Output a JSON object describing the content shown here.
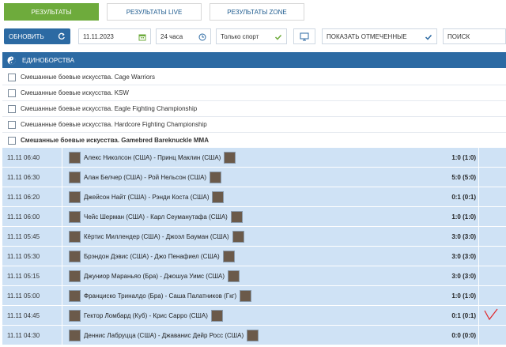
{
  "tabs": [
    {
      "label": "РЕЗУЛЬТАТЫ",
      "active": true
    },
    {
      "label": "РЕЗУЛЬТАТЫ LIVE",
      "active": false
    },
    {
      "label": "РЕЗУЛЬТАТЫ ZONE",
      "active": false
    }
  ],
  "toolbar": {
    "refresh_label": "ОБНОВИТЬ",
    "date_value": "11.11.2023",
    "period_value": "24 часа",
    "sport_value": "Только спорт",
    "show_marked_label": "ПОКАЗАТЬ ОТМЕЧЕННЫЕ",
    "search_placeholder": "ПОИСК"
  },
  "section": {
    "title": "ЕДИНОБОРСТВА"
  },
  "categories": [
    {
      "label": "Смешанные боевые искусства. Cage Warriors"
    },
    {
      "label": "Смешанные боевые искусства. KSW"
    },
    {
      "label": "Смешанные боевые искусства. Eagle Fighting Championship"
    },
    {
      "label": "Смешанные боевые искусства. Hardcore Fighting Championship"
    },
    {
      "label": "Смешанные боевые искусства. Gamebred Bareknuckle MMA"
    }
  ],
  "events": [
    {
      "time": "11.11 06:40",
      "match": "Алекс Николсон (США) - Принц Маклин (США)",
      "score": "1:0 (1:0)"
    },
    {
      "time": "11.11 06:30",
      "match": "Алан Белчер (США) - Рой Нельсон (США)",
      "score": "5:0 (5:0)"
    },
    {
      "time": "11.11 06:20",
      "match": "Джейсон Найт (США) - Рэнди Коста (США)",
      "score": "0:1 (0:1)"
    },
    {
      "time": "11.11 06:00",
      "match": "Чейс Шерман (США) - Карл Сеуманутафа (США)",
      "score": "1:0 (1:0)"
    },
    {
      "time": "11.11 05:45",
      "match": "Кёртис Миллендер (США) - Джоэл Бауман (США)",
      "score": "3:0 (3:0)"
    },
    {
      "time": "11.11 05:30",
      "match": "Брэндон Дэвис (США) - Джо Пенафиел (США)",
      "score": "3:0 (3:0)"
    },
    {
      "time": "11.11 05:15",
      "match": "Джуниор Мараньяо (Бра) - Джошуа Уимс (США)",
      "score": "3:0 (3:0)"
    },
    {
      "time": "11.11 05:00",
      "match": "Франциско Триналдо (Бра) - Саша Палатников (Гкг)",
      "score": "1:0 (1:0)"
    },
    {
      "time": "11.11 04:45",
      "match": "Гектор Ломбард (Куб) - Крис Сарро (США)",
      "score": "0:1 (0:1)",
      "marked": true
    },
    {
      "time": "11.11 04:30",
      "match": "Деннис Лабруцца (США) - Джаванис Дейр Росс (США)",
      "score": "0:0 (0:0)"
    }
  ]
}
